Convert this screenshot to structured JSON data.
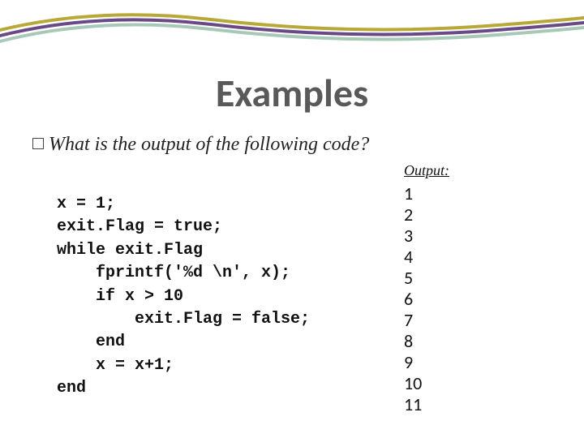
{
  "title": "Examples",
  "question": "What is the output of the following code?",
  "outputLabel": "Output:",
  "code": "x = 1;\nexit.Flag = true;\nwhile exit.Flag\n    fprintf('%d \\n', x);\n    if x > 10\n        exit.Flag = false;\n    end\n    x = x+1;\nend",
  "output": "1\n2\n3\n4\n5\n6\n7\n8\n9\n10\n11"
}
